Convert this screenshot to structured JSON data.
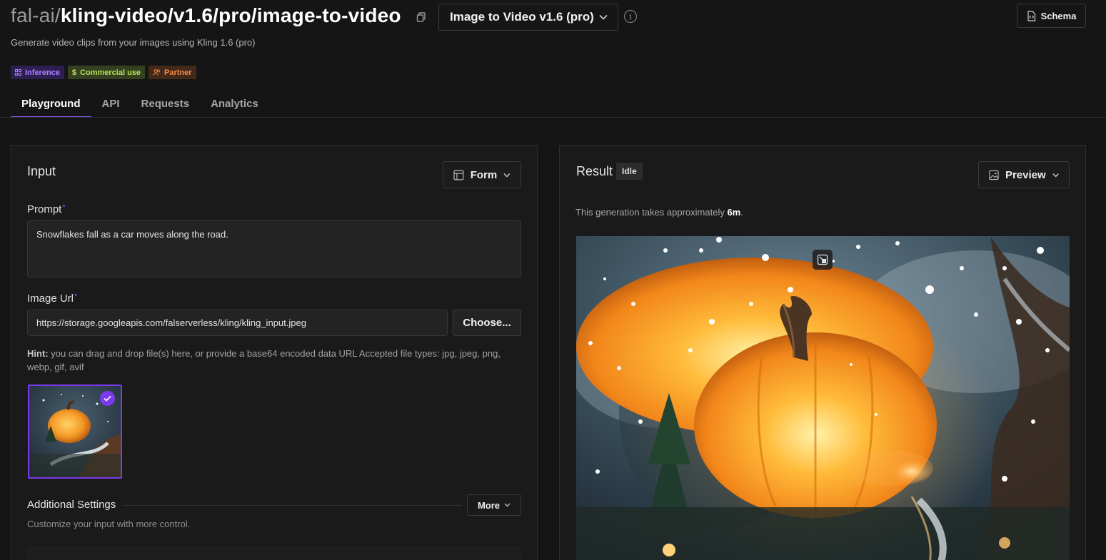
{
  "header": {
    "owner": "fal-ai/",
    "slug": "kling-video/v1.6/pro/image-to-video",
    "subtitle": "Generate video clips from your images using Kling 1.6 (pro)",
    "version_select": "Image to Video v1.6 (pro)",
    "schema_label": "Schema"
  },
  "badges": {
    "inference": "Inference",
    "commercial": "Commercial use",
    "partner": "Partner"
  },
  "tabs": [
    {
      "label": "Playground",
      "active": true
    },
    {
      "label": "API",
      "active": false
    },
    {
      "label": "Requests",
      "active": false
    },
    {
      "label": "Analytics",
      "active": false
    }
  ],
  "input": {
    "title": "Input",
    "mode_select": "Form",
    "prompt_label": "Prompt",
    "required_mark": "*",
    "prompt_value": "Snowflakes fall as a car moves along the road.",
    "image_url_label": "Image Url",
    "image_url_value": "https://storage.googleapis.com/falserverless/kling/kling_input.jpeg",
    "choose_label": "Choose...",
    "hint_bold": "Hint:",
    "hint_text": " you can drag and drop file(s) here, or provide a base64 encoded data URL Accepted file types: jpg, jpeg, png, webp, gif, avif",
    "additional_title": "Additional Settings",
    "additional_sub": "Customize your input with more control.",
    "more_label": "More"
  },
  "result": {
    "title": "Result",
    "status": "Idle",
    "view_select": "Preview",
    "gen_note_prefix": "This generation takes approximately ",
    "gen_note_time": "6m",
    "gen_note_suffix": "."
  },
  "colors": {
    "accent": "#8b5cf6",
    "background": "#151515",
    "panel": "#1a1a1a"
  },
  "icons": [
    "copy-icon",
    "chevron-down-icon",
    "info-icon",
    "code-file-icon",
    "layout-icon",
    "image-icon",
    "check-icon",
    "expand-icon"
  ]
}
